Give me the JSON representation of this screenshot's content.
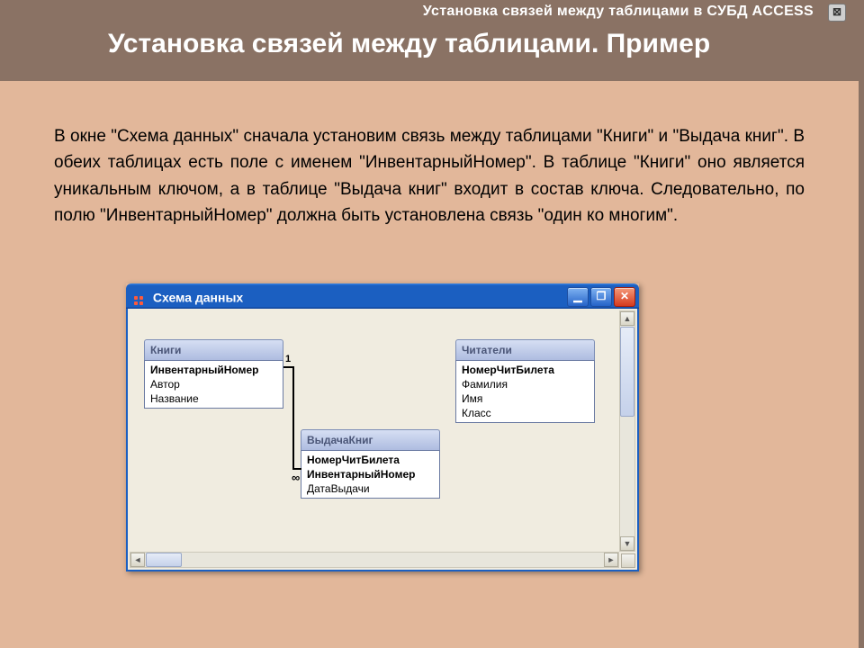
{
  "header": {
    "breadcrumb": "Установка связей между таблицами в  СУБД ACCESS",
    "title": "Установка связей между таблицами. Пример",
    "close_glyph": "⊠"
  },
  "paragraph": "В окне \"Схема данных\" сначала установим связь между таблицами \"Книги\" и \"Выдача книг\". В обеих таблицах есть поле с именем \"ИнвентарныйНомер\". В таблице \"Книги\" оно является уникальным ключом, а в таблице \"Выдача книг\" входит в состав ключа. Следовательно, по полю  \"ИнвентарныйНомер\" должна быть установлена связь \"один ко многим\".",
  "window": {
    "title": "Схема данных",
    "minimize": "▁",
    "maximize": "❐",
    "close": "✕",
    "scroll_left": "◄",
    "scroll_right": "►",
    "scroll_up": "▲",
    "scroll_down": "▼",
    "relation": {
      "one": "1",
      "many": "∞"
    },
    "tables": {
      "books": {
        "title": "Книги",
        "fields": [
          "ИнвентарныйНомер",
          "Автор",
          "Название"
        ],
        "keys": [
          0
        ]
      },
      "issues": {
        "title": "ВыдачаКниг",
        "fields": [
          "НомерЧитБилета",
          "ИнвентарныйНомер",
          "ДатаВыдачи"
        ],
        "keys": [
          0,
          1
        ]
      },
      "readers": {
        "title": "Читатели",
        "fields": [
          "НомерЧитБилета",
          "Фамилия",
          "Имя",
          "Класс"
        ],
        "keys": [
          0
        ]
      }
    }
  }
}
